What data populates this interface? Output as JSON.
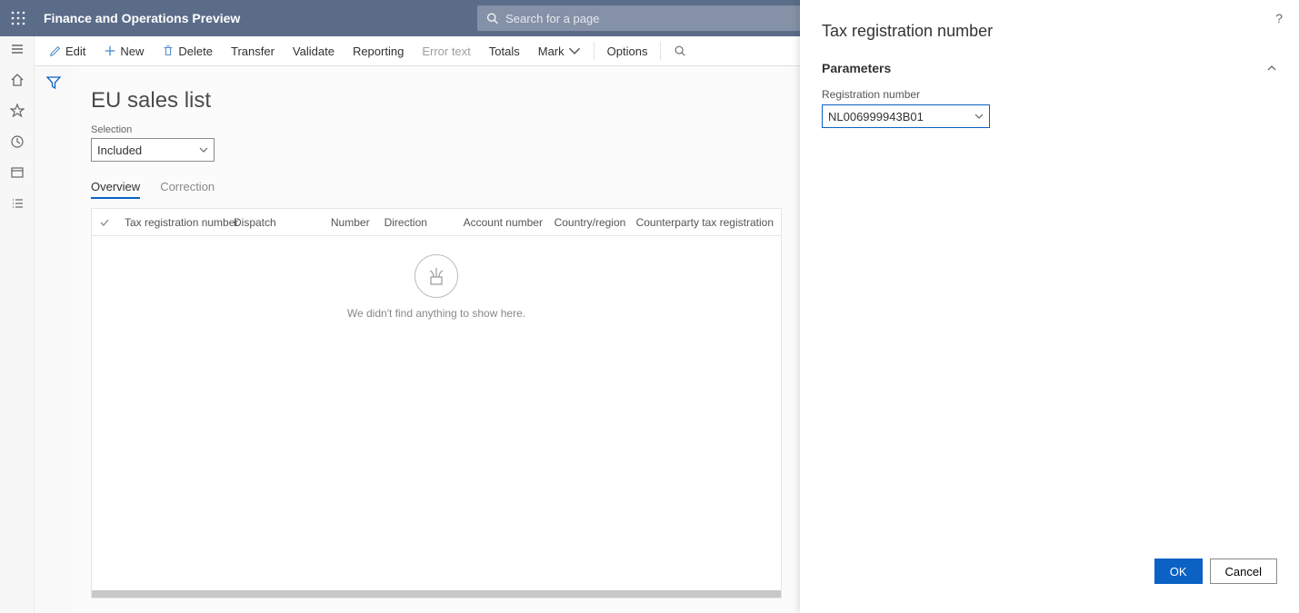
{
  "app": {
    "title": "Finance and Operations Preview",
    "search_placeholder": "Search for a page"
  },
  "commands": {
    "edit": "Edit",
    "new": "New",
    "delete": "Delete",
    "transfer": "Transfer",
    "validate": "Validate",
    "reporting": "Reporting",
    "error_text": "Error text",
    "totals": "Totals",
    "mark": "Mark",
    "options": "Options"
  },
  "page": {
    "title": "EU sales list",
    "selection_label": "Selection",
    "selection_value": "Included",
    "tabs": {
      "overview": "Overview",
      "correction": "Correction"
    }
  },
  "grid": {
    "cols": {
      "tax_reg": "Tax registration number",
      "dispatch": "Dispatch",
      "number": "Number",
      "direction": "Direction",
      "account": "Account number",
      "country": "Country/region",
      "cpty": "Counterparty tax registration"
    },
    "empty_text": "We didn't find anything to show here."
  },
  "panel": {
    "title": "Tax registration number",
    "section": "Parameters",
    "reg_label": "Registration number",
    "reg_value": "NL006999943B01",
    "ok": "OK",
    "cancel": "Cancel"
  }
}
